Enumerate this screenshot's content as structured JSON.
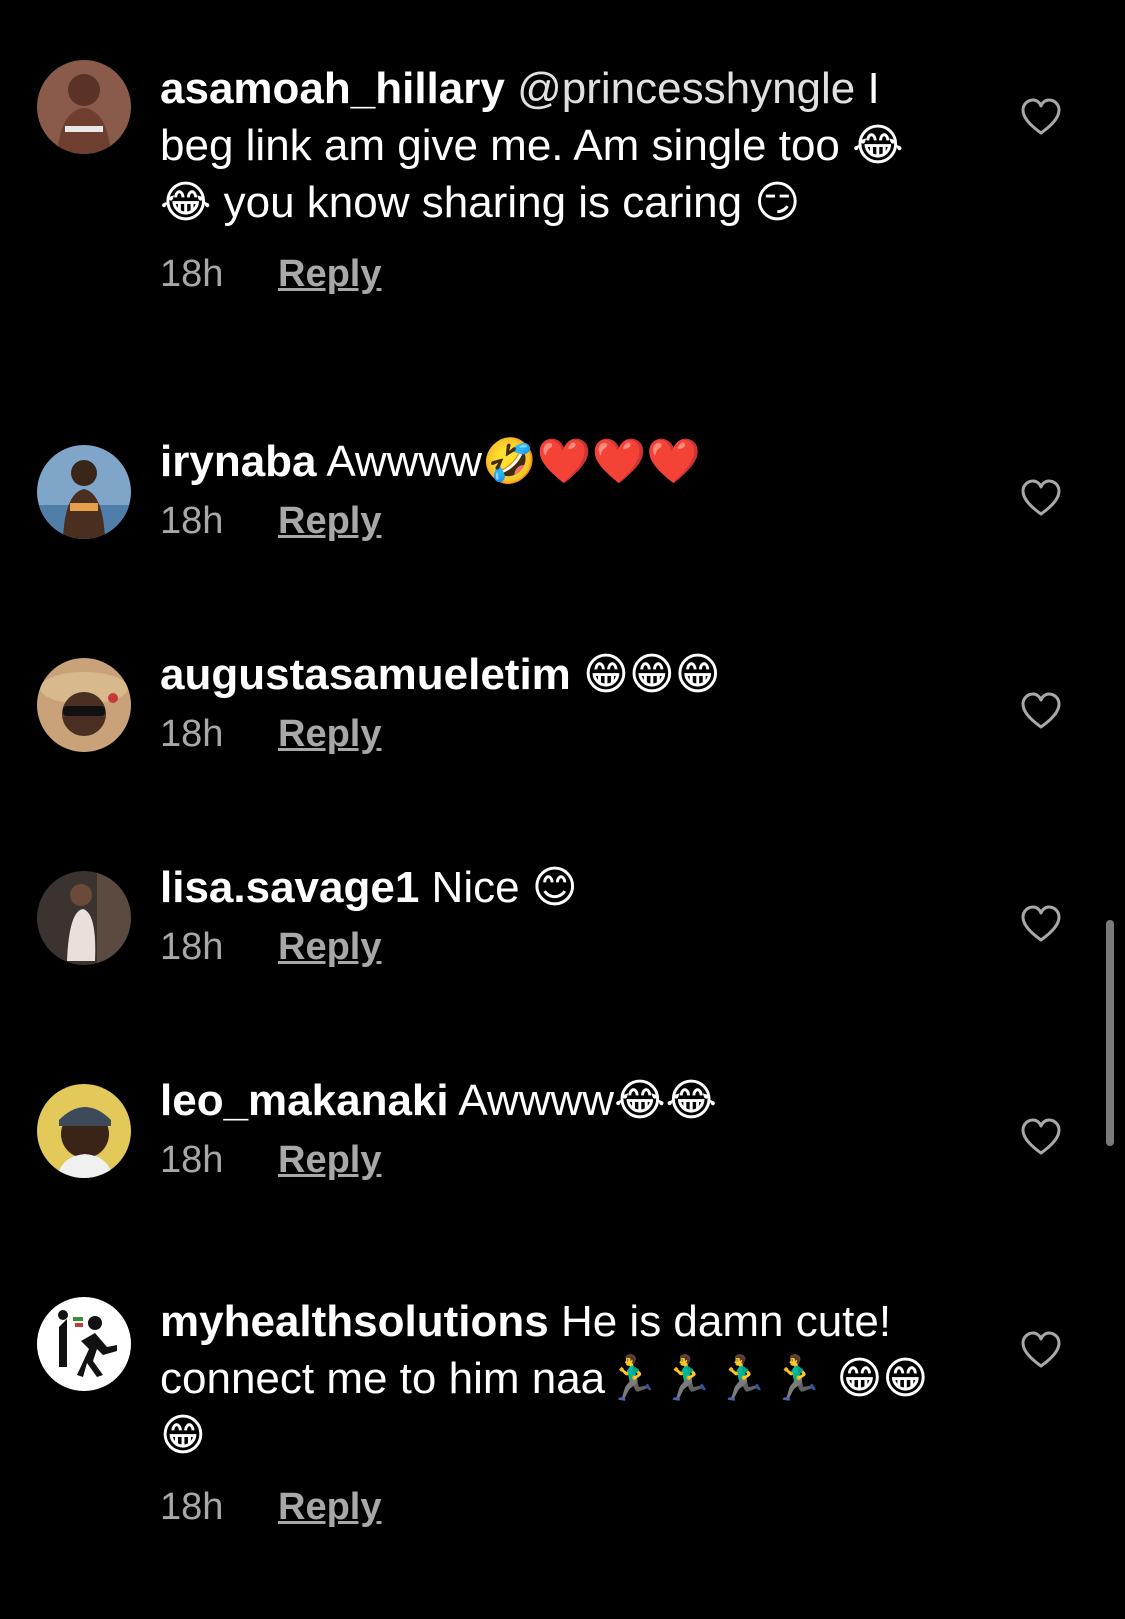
{
  "comments": [
    {
      "username": "asamoah_hillary",
      "mention": "@princesshyngle",
      "text": " I beg link am give me. Am single too 😂 😂  you know sharing is caring 😏",
      "time": "18h",
      "reply_label": "Reply",
      "avatar_icon": "avatar-photo"
    },
    {
      "username": "irynaba",
      "mention": "",
      "text": " Awwww🤣❤️❤️❤️",
      "time": "18h",
      "reply_label": "Reply",
      "avatar_icon": "avatar-photo"
    },
    {
      "username": "augustasamueletim",
      "mention": "",
      "text": " 😁😁😁",
      "time": "18h",
      "reply_label": "Reply",
      "avatar_icon": "avatar-photo"
    },
    {
      "username": "lisa.savage1",
      "mention": "",
      "text": " Nice 😊",
      "time": "18h",
      "reply_label": "Reply",
      "avatar_icon": "avatar-photo"
    },
    {
      "username": "leo_makanaki",
      "mention": "",
      "text": " Awwww😂😂",
      "time": "18h",
      "reply_label": "Reply",
      "avatar_icon": "avatar-photo"
    },
    {
      "username": "myhealthsolutions",
      "mention": "",
      "text": " He is damn cute! connect me to him naa🏃‍♂️🏃‍♂️🏃‍♂️🏃‍♂️ 😁😁😁",
      "time": "18h",
      "reply_label": "Reply",
      "avatar_icon": "logo-runner"
    }
  ],
  "icons": {
    "like": "heart-outline-icon"
  },
  "colors": {
    "background": "#000000",
    "text": "#ffffff",
    "secondary": "#a8a8a8"
  }
}
